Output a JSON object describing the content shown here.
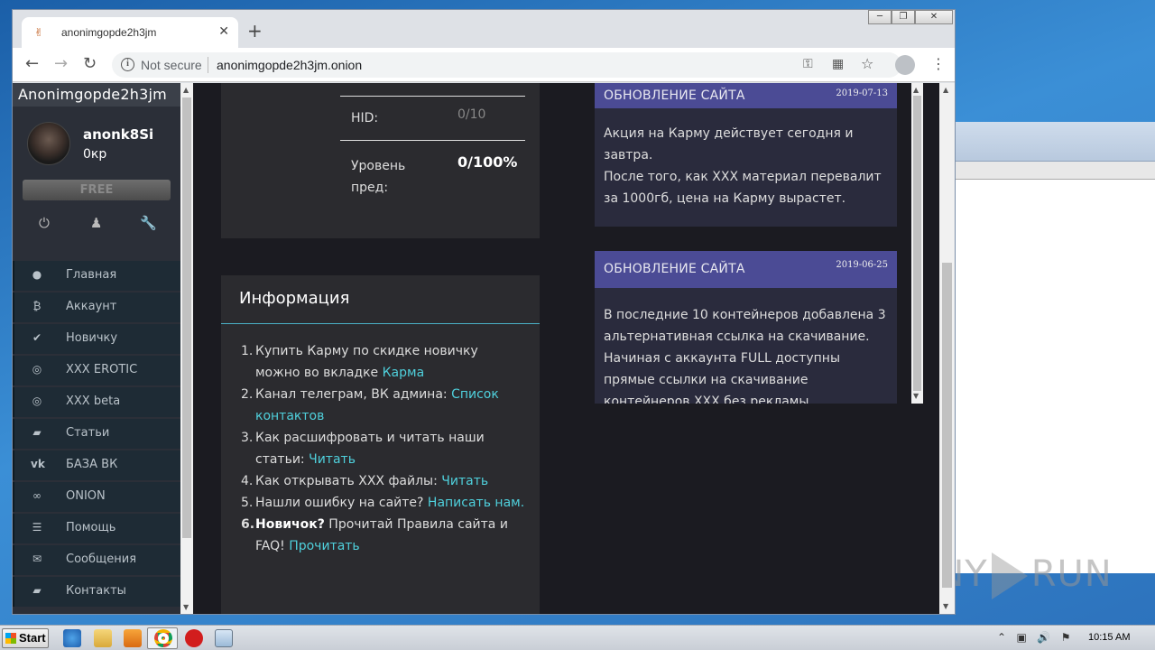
{
  "browser": {
    "tab_title": "anonimgopde2h3jm",
    "not_secure": "Not secure",
    "url": "anonimgopde2h3jm.onion"
  },
  "sidebar": {
    "site_title": "Anonimgopde2h3jm",
    "username": "anonk8Si",
    "balance": "0кр",
    "badge": "FREE",
    "items": [
      {
        "icon": "●",
        "label": "Главная"
      },
      {
        "icon": "₿",
        "label": "Аккаунт"
      },
      {
        "icon": "✔",
        "label": "Новичку"
      },
      {
        "icon": "◎",
        "label": "XXX EROTIC"
      },
      {
        "icon": "◎",
        "label": "XXX beta"
      },
      {
        "icon": "▰",
        "label": "Статьи"
      },
      {
        "icon": "vk",
        "label": "БАЗА ВК"
      },
      {
        "icon": "∞",
        "label": "ONION"
      },
      {
        "icon": "☰",
        "label": "Помощь"
      },
      {
        "icon": "✉",
        "label": "Сообщения"
      },
      {
        "icon": "▰",
        "label": "Контакты"
      }
    ]
  },
  "stats": {
    "hid_label": "HID:",
    "hid_value": "0/10",
    "level_label": "Уровень пред:",
    "level_value": "0/100%"
  },
  "info": {
    "title": "Информация",
    "items": [
      {
        "n": "1.",
        "text": "Купить Карму по скидке новичку можно во вкладке ",
        "link": "Карма"
      },
      {
        "n": "2.",
        "text": "Канал телеграм, ВК админа: ",
        "link": "Список контактов"
      },
      {
        "n": "3.",
        "text": "Как расшифровать и читать наши статьи: ",
        "link": "Читать"
      },
      {
        "n": "4.",
        "text": "Как открывать XXX файлы: ",
        "link": "Читать"
      },
      {
        "n": "5.",
        "text": "Нашли ошибку на сайте? ",
        "link": "Написать нам."
      },
      {
        "n": "6.",
        "bold": "Новичок?",
        "text": " Прочитай Правила сайта и FAQ! ",
        "link": "Прочитать"
      }
    ]
  },
  "news": [
    {
      "title": "ОБНОВЛЕНИЕ САЙТА",
      "date": "2019-07-13",
      "body": "Акция на Карму действует сегодня и завтра.\nПосле того, как XXX материал перевалит за 1000гб, цена на Карму вырастет."
    },
    {
      "title": "ОБНОВЛЕНИЕ САЙТА",
      "date": "2019-06-25",
      "body": "В последние 10 контейнеров добавлена 3 альтернативная ссылка на скачивание. Начиная с аккаунта FULL доступны прямые ссылки на скачивание контейнеров XXX без рекламы"
    }
  ],
  "watermark": "ANY RUN",
  "taskbar": {
    "start_label": "Start",
    "clock": "10:15 AM"
  }
}
